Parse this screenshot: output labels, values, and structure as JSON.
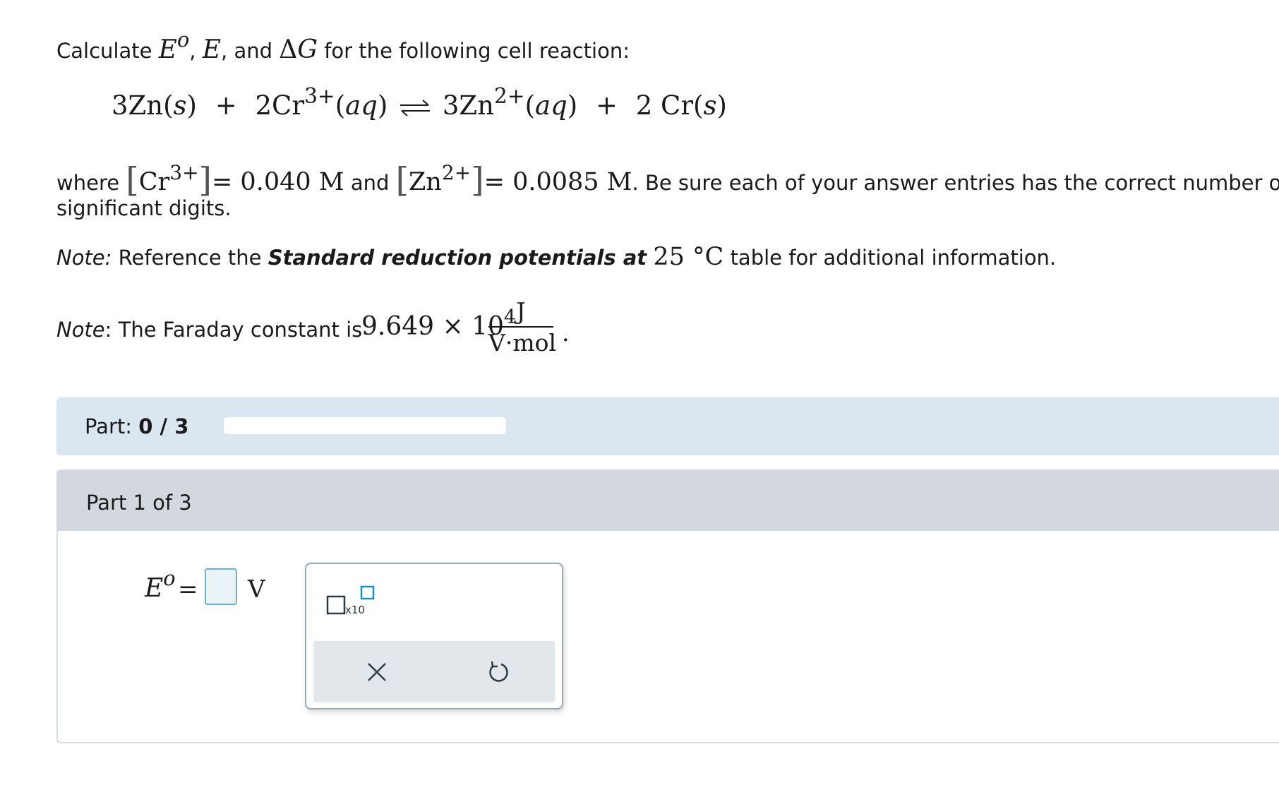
{
  "question": {
    "calculate_label": "Calculate",
    "E0_symbol": "E",
    "E0_sup": "o",
    "E_symbol": "E",
    "dG_symbol": "ΔG",
    "and_label": "and",
    "intro_tail": "for the following cell reaction:",
    "reaction": {
      "reactant1": "3Zn",
      "reactant1_state": "s",
      "reactant2": "2Cr",
      "reactant2_charge": "3+",
      "reactant2_state": "aq",
      "product1": "3Zn",
      "product1_charge": "2+",
      "product1_state": "aq",
      "product2": "2 Cr",
      "product2_state": "s",
      "plus": "+"
    },
    "where_label": "where",
    "cr_ion": "Cr",
    "cr_charge": "3+",
    "cr_conc": "= 0.040 M",
    "zn_ion": "Zn",
    "zn_charge": "2+",
    "zn_conc": "= 0.0085 M",
    "sigfig_text_1": ". Be sure each of your answer entries has the correct number of",
    "sigfig_text_2": "significant digits.",
    "note_label": "Note:",
    "note1_text_a": "Reference the",
    "note1_bold": "Standard reduction potentials at",
    "note1_temp": "25 °C",
    "note1_text_b": "table for additional information.",
    "note2_label": "Note",
    "note2_text": ": The Faraday constant is",
    "faraday_mantissa": "9.649 × 10",
    "faraday_exp": "4",
    "faraday_unit_num": "J",
    "faraday_unit_den": "V·mol",
    "faraday_period": "."
  },
  "progress": {
    "part_label": "Part:",
    "part_value": "0 / 3",
    "fraction": 0.0
  },
  "part": {
    "title": "Part 1 of 3",
    "answer_symbol": "E",
    "answer_sup": "o",
    "equals": "=",
    "unit": "V",
    "input_value": "",
    "x10_label": "x10"
  },
  "icons": {
    "x10": "superscript-x10-icon",
    "clear": "close-icon",
    "undo": "undo-icon"
  },
  "colors": {
    "progress_bg": "#dbe7f0",
    "part_header_bg": "#d3d8de",
    "input_border": "#6fb1c8",
    "input_bg": "#e8f4f8",
    "tool_actions_bg": "#e1e7ea",
    "icon_color": "#2b3a44",
    "x10_accent": "#1f8fb8"
  }
}
